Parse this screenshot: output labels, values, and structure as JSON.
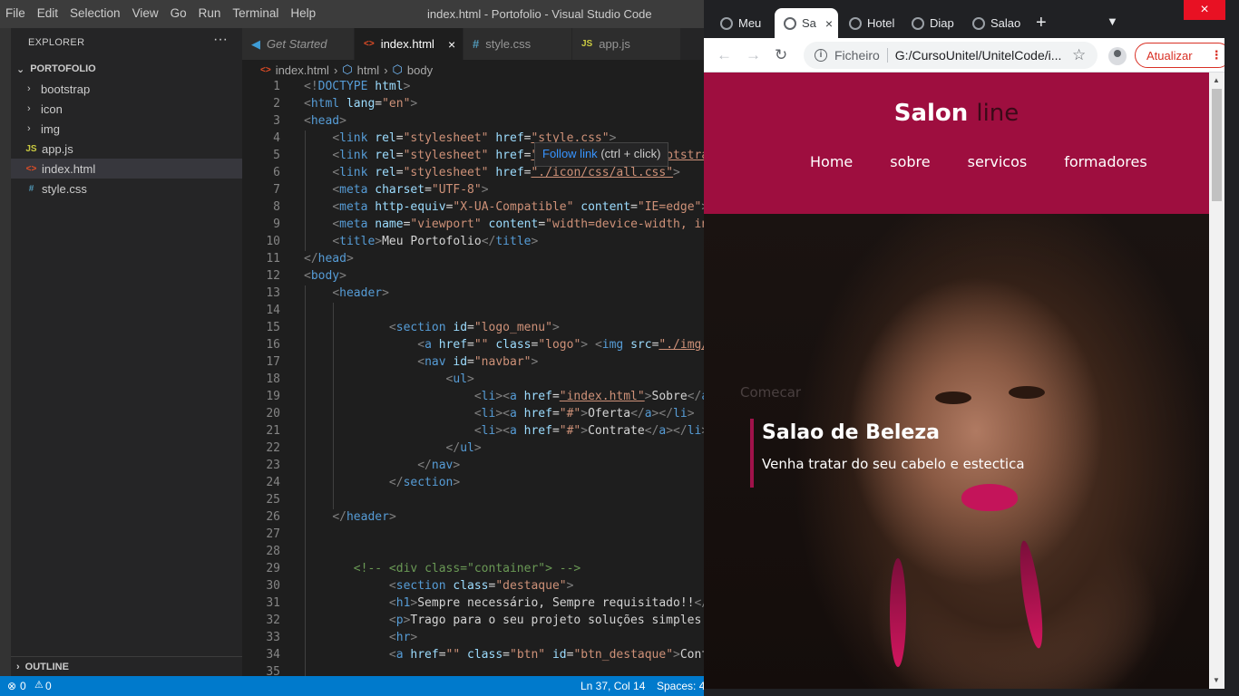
{
  "vscode": {
    "menu": [
      "File",
      "Edit",
      "Selection",
      "View",
      "Go",
      "Run",
      "Terminal",
      "Help"
    ],
    "window_title": "index.html - Portofolio - Visual Studio Code",
    "explorer_title": "EXPLORER",
    "explorer_more": "···",
    "folder": "PORTOFOLIO",
    "tree": [
      {
        "label": "bootstrap",
        "type": "folder"
      },
      {
        "label": "icon",
        "type": "folder"
      },
      {
        "label": "img",
        "type": "folder"
      },
      {
        "label": "app.js",
        "type": "js"
      },
      {
        "label": "index.html",
        "type": "html",
        "selected": true
      },
      {
        "label": "style.css",
        "type": "css"
      }
    ],
    "outline": "OUTLINE",
    "tabs": [
      {
        "label": "Get Started"
      },
      {
        "label": "index.html",
        "active": true
      },
      {
        "label": "style.css"
      },
      {
        "label": "app.js"
      }
    ],
    "breadcrumbs": [
      "index.html",
      "html",
      "body"
    ],
    "tooltip": {
      "link": "Follow link",
      "hint": "(ctrl + click)"
    },
    "code_lines": [
      "<!DOCTYPE html>",
      "<html lang=\"en\">",
      "<head>",
      "    <link rel=\"stylesheet\" href=\"style.css\">",
      "    <link rel=\"stylesheet\" href=\"./bootstrap/css/bootstra",
      "    <link rel=\"stylesheet\" href=\"./icon/css/all.css\">",
      "    <meta charset=\"UTF-8\">",
      "    <meta http-equiv=\"X-UA-Compatible\" content=\"IE=edge\">",
      "    <meta name=\"viewport\" content=\"width=device-width, in",
      "    <title>Meu Portofolio</title>",
      "</head>",
      "<body>",
      "    <header>",
      "",
      "            <section id=\"logo_menu\">",
      "                <a href=\"\" class=\"logo\"> <img src=\"./img/",
      "                <nav id=\"navbar\">",
      "                    <ul>",
      "                        <li><a href=\"index.html\">Sobre</a>",
      "                        <li><a href=\"#\">Oferta</a></li>",
      "                        <li><a href=\"#\">Contrate</a></li>",
      "                    </ul>",
      "                </nav>",
      "            </section>",
      "",
      "    </header>",
      "",
      "",
      "       <!-- <div class=\"container\"> -->",
      "            <section class=\"destaque\">",
      "            <h1>Sempre necessário, Sempre requisitado!!</",
      "            <p>Trago para o seu projeto soluções simples",
      "            <hr>",
      "            <a href=\"\" class=\"btn\" id=\"btn_destaque\">Cont",
      ""
    ],
    "status": {
      "errors": "0",
      "warnings": "0",
      "position": "Ln 37, Col 14",
      "spaces": "Spaces: 4"
    }
  },
  "chrome": {
    "tabs": [
      {
        "label": "Meu"
      },
      {
        "label": "Sa",
        "active": true
      },
      {
        "label": "Hotel"
      },
      {
        "label": "Diap"
      },
      {
        "label": "Salao"
      }
    ],
    "new_tab": "+",
    "address_scheme": "Ficheiro",
    "address_url": "G:/CursoUnitel/UnitelCode/i...",
    "update_label": "Atualizar",
    "colors": {
      "header": "#9e0e3f",
      "accent": "#a0124a",
      "update": "#d93025"
    }
  },
  "site": {
    "logo_main": "Salon",
    "logo_accent": "line",
    "nav": [
      "Home",
      "sobre",
      "servicos",
      "formadores"
    ],
    "comecar": "Comecar",
    "hero_title": "Salao de Beleza",
    "hero_subtitle": "Venha tratar do seu cabelo e estectica"
  }
}
